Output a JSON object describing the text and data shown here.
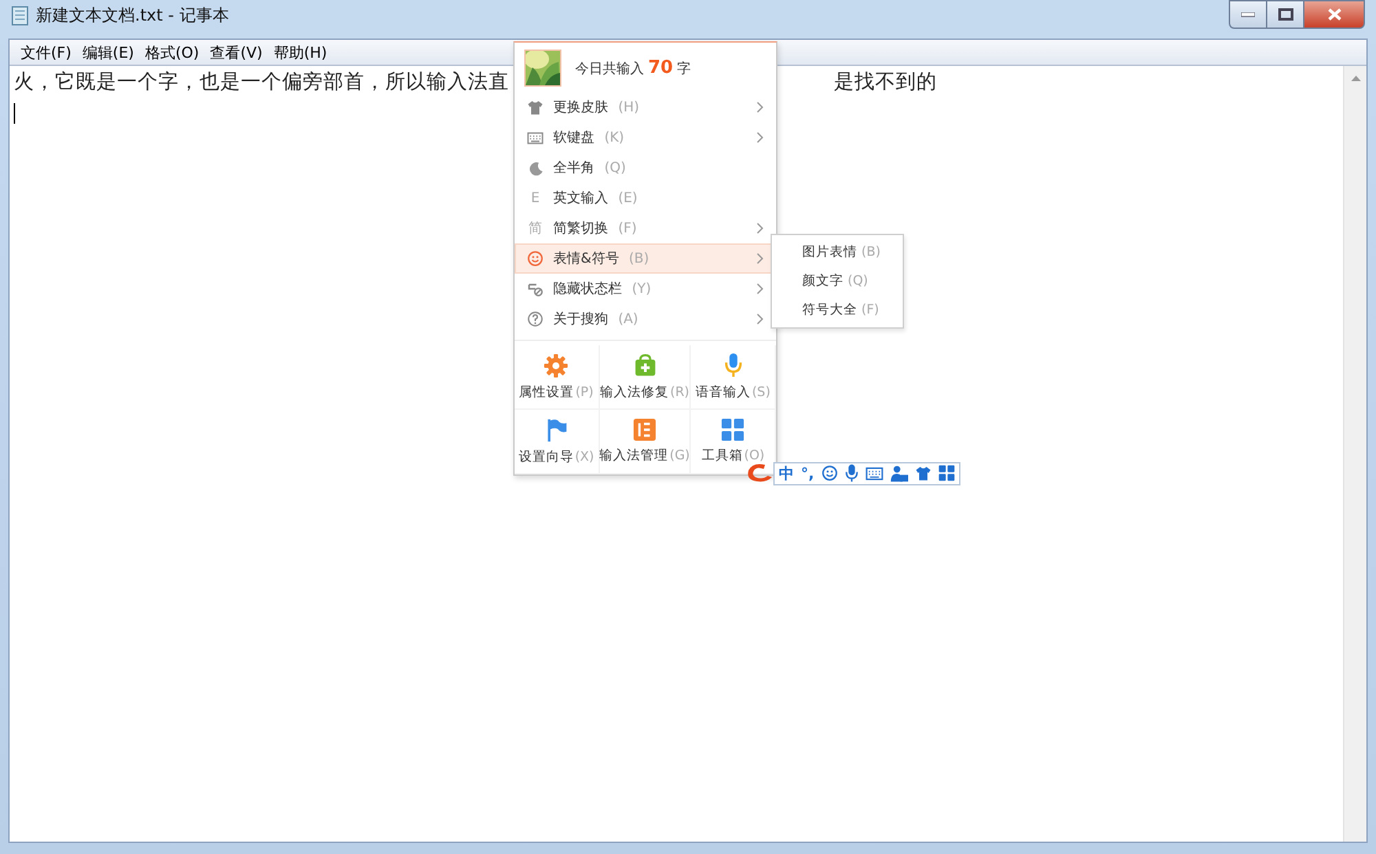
{
  "window": {
    "title": "新建文本文档.txt - 记事本"
  },
  "menu_bar": [
    "文件(F)",
    "编辑(E)",
    "格式(O)",
    "查看(V)",
    "帮助(H)"
  ],
  "document": {
    "text_before_menu": "火，它既是一个字，也是一个偏旁部首，所以输入法直",
    "text_after_menu": "是找不到的"
  },
  "ime_menu": {
    "header": {
      "prefix": "今日共输入",
      "count": "70",
      "suffix": "字"
    },
    "items": [
      {
        "kind": "icon",
        "label": "更换皮肤",
        "shortcut": "(H)",
        "submenu": true,
        "selected": false
      },
      {
        "kind": "icon",
        "label": "软键盘",
        "shortcut": "(K)",
        "submenu": true,
        "selected": false
      },
      {
        "kind": "icon",
        "label": "全半角",
        "shortcut": "(Q)",
        "submenu": false,
        "selected": false
      },
      {
        "kind": "glyph",
        "glyph": "E",
        "label": "英文输入",
        "shortcut": "(E)",
        "submenu": false,
        "selected": false
      },
      {
        "kind": "glyph",
        "glyph": "简",
        "label": "简繁切换",
        "shortcut": "(F)",
        "submenu": true,
        "selected": false
      },
      {
        "kind": "icon",
        "label": "表情&符号",
        "shortcut": "(B)",
        "submenu": true,
        "selected": true
      },
      {
        "kind": "icon",
        "label": "隐藏状态栏",
        "shortcut": "(Y)",
        "submenu": true,
        "selected": false
      },
      {
        "kind": "icon",
        "label": "关于搜狗",
        "shortcut": "(A)",
        "submenu": true,
        "selected": false
      }
    ],
    "grid": [
      {
        "label": "属性设置",
        "shortcut": "(P)"
      },
      {
        "label": "输入法修复",
        "shortcut": "(R)"
      },
      {
        "label": "语音输入",
        "shortcut": "(S)"
      },
      {
        "label": "设置向导",
        "shortcut": "(X)"
      },
      {
        "label": "输入法管理",
        "shortcut": "(G)"
      },
      {
        "label": "工具箱",
        "shortcut": "(O)"
      }
    ]
  },
  "submenu": {
    "items": [
      {
        "label": "图片表情",
        "shortcut": "(B)"
      },
      {
        "label": "颜文字",
        "shortcut": "(Q)"
      },
      {
        "label": "符号大全",
        "shortcut": "(F)"
      }
    ]
  },
  "ime_status_bar": {
    "mode": "中",
    "punctuation": "°,"
  }
}
